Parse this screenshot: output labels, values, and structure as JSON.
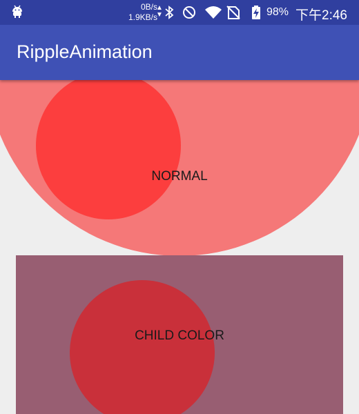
{
  "status_bar": {
    "app_icon": "android-icon",
    "net_up": "0B/s",
    "net_down": "1.9KB/s",
    "icons": [
      "bluetooth-icon",
      "do-not-disturb-icon",
      "wifi-icon",
      "no-sim-icon",
      "battery-charging-icon"
    ],
    "battery": "98%",
    "time": "下午2:46"
  },
  "toolbar": {
    "title": "RippleAnimation"
  },
  "main": {
    "normal_label": "NORMAL",
    "child_label": "CHILD COLOR"
  },
  "colors": {
    "status_bar": "#303f9f",
    "toolbar": "#3f51b5",
    "background": "#eeeeee",
    "normal_view": "#f57878",
    "normal_ripple": "#fc3e3e",
    "child_view": "#985e72",
    "child_ripple": "#c9303a"
  }
}
